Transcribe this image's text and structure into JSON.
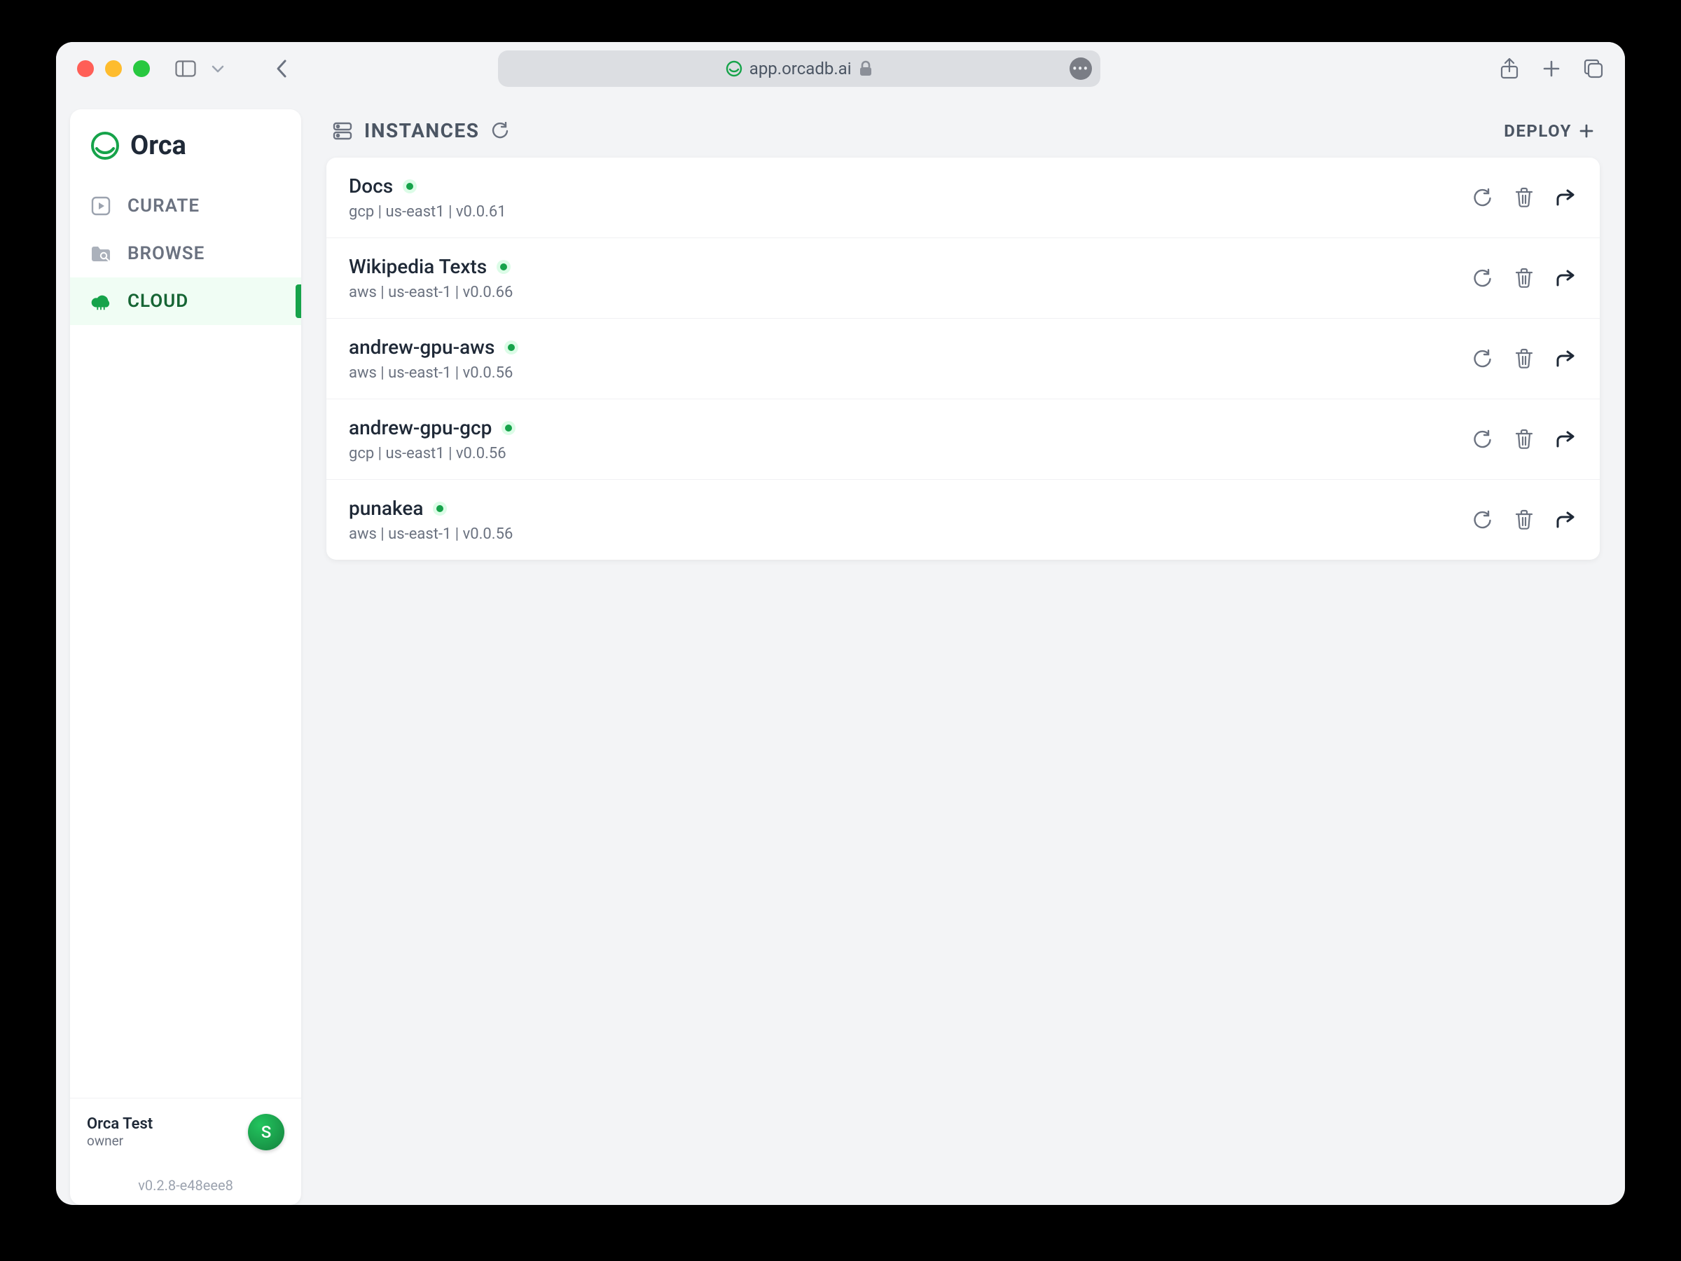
{
  "browser": {
    "address": "app.orcadb.ai"
  },
  "brand": {
    "name": "Orca"
  },
  "sidebar": {
    "items": [
      {
        "label": "CURATE",
        "icon": "curate-icon"
      },
      {
        "label": "BROWSE",
        "icon": "browse-icon"
      },
      {
        "label": "CLOUD",
        "icon": "cloud-icon"
      }
    ],
    "active_index": 2
  },
  "user": {
    "name": "Orca Test",
    "role": "owner",
    "avatar_initial": "S"
  },
  "app_version": "v0.2.8-e48eee8",
  "main": {
    "title": "INSTANCES",
    "deploy_label": "DEPLOY",
    "instances": [
      {
        "name": "Docs",
        "provider": "gcp",
        "region": "us-east1",
        "version": "v0.0.61",
        "status": "running"
      },
      {
        "name": "Wikipedia Texts",
        "provider": "aws",
        "region": "us-east-1",
        "version": "v0.0.66",
        "status": "running"
      },
      {
        "name": "andrew-gpu-aws",
        "provider": "aws",
        "region": "us-east-1",
        "version": "v0.0.56",
        "status": "running"
      },
      {
        "name": "andrew-gpu-gcp",
        "provider": "gcp",
        "region": "us-east1",
        "version": "v0.0.56",
        "status": "running"
      },
      {
        "name": "punakea",
        "provider": "aws",
        "region": "us-east-1",
        "version": "v0.0.56",
        "status": "running"
      }
    ]
  }
}
